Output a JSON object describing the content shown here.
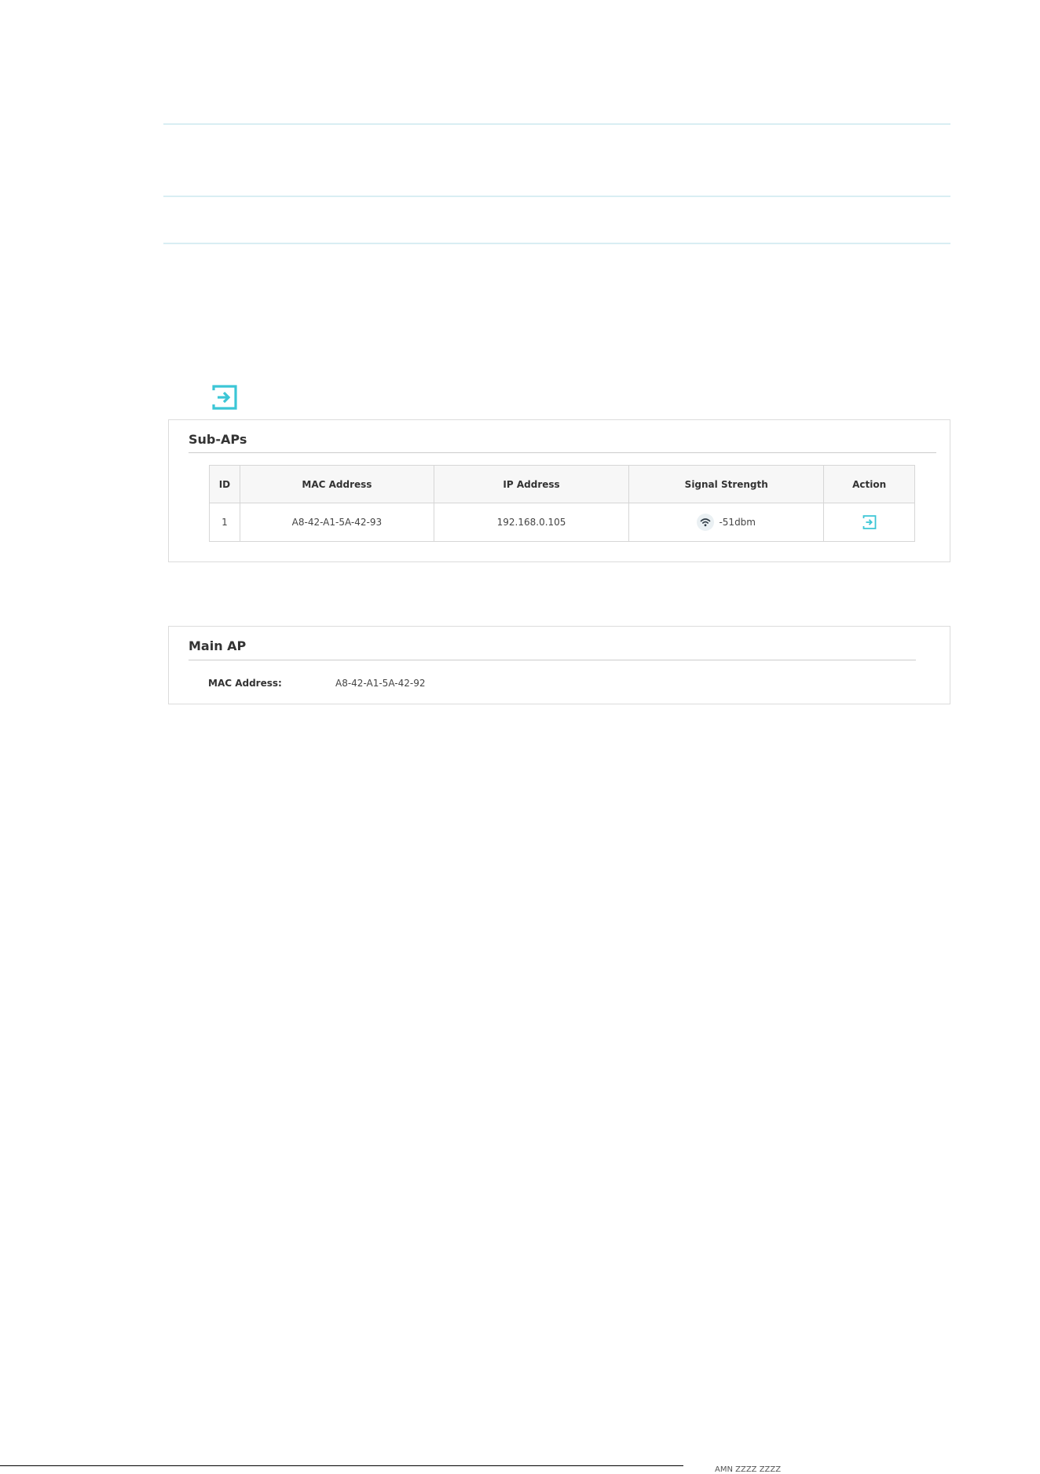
{
  "sub_aps": {
    "title": "Sub-APs",
    "columns": [
      "ID",
      "MAC Address",
      "IP Address",
      "Signal Strength",
      "Action"
    ],
    "rows": [
      {
        "id": "1",
        "mac": "A8-42-A1-5A-42-93",
        "ip": "192.168.0.105",
        "signal": "-51dbm",
        "signal_icon": "wifi-signal-icon",
        "action_icon": "login-icon"
      }
    ]
  },
  "main_ap": {
    "title": "Main AP",
    "mac_label": "MAC Address:",
    "mac_value": "A8-42-A1-5A-42-92"
  },
  "footer": {
    "text": "AMN ZZZZ ZZZZ"
  },
  "colors": {
    "accent": "#3cc6d6",
    "rule": "#d9eef3",
    "border": "#dcdcdc"
  }
}
